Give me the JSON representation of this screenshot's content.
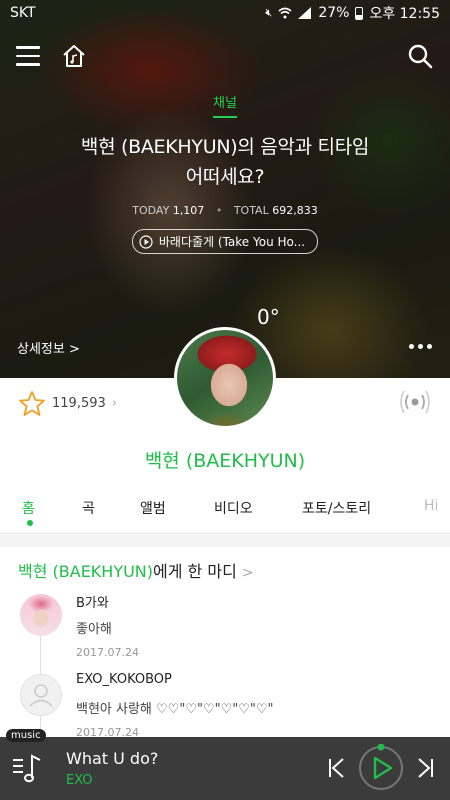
{
  "status_bar": {
    "carrier": "SKT",
    "battery": "27%",
    "time": "오후 12:55"
  },
  "hero": {
    "channel_label": "채널",
    "title_line1": "백현 (BAEKHYUN)의 음악과 티타임",
    "title_line2": "어떠세요?",
    "today_label": "TODAY",
    "today_value": "1,107",
    "total_label": "TOTAL",
    "total_value": "692,833",
    "song": "바래다줄게 (Take You Ho...",
    "degree": "0°",
    "details_label": "상세정보 >"
  },
  "profile": {
    "likes": "119,593",
    "artist_name": "백현 (BAEKHYUN)"
  },
  "tabs": [
    "홈",
    "곡",
    "앨범",
    "비디오",
    "포토/스토리",
    "Hi"
  ],
  "comments_section": {
    "title_highlight": "백현 (BAEKHYUN)",
    "title_rest": "에게 한 마디",
    "chevron": ">",
    "items": [
      {
        "user": "B가와",
        "text": "좋아해",
        "date": "2017.07.24"
      },
      {
        "user": "EXO_KOKOBOP",
        "text": "백현아 사랑해  ♡♡\"♡\"♡\"♡\"♡\"♡\"",
        "date": "2017.07.24"
      }
    ]
  },
  "player": {
    "badge": "music",
    "title": "What U do?",
    "artist": "EXO"
  },
  "colors": {
    "accent": "#1fbf49",
    "player_bg": "#3b3b3b"
  }
}
